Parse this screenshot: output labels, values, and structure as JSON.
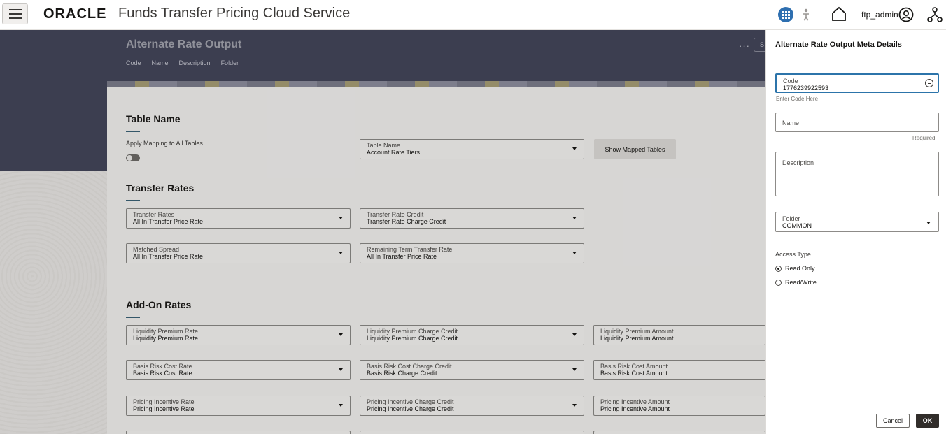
{
  "header": {
    "logo": "ORACLE",
    "app_title": "Funds Transfer Pricing Cloud Service",
    "username": "ftp_admin"
  },
  "page": {
    "title": "Alternate Rate Output",
    "subnav": [
      "Code",
      "Name",
      "Description",
      "Folder"
    ],
    "more": "···",
    "save_stub": "S"
  },
  "table_name_section": {
    "title": "Table Name",
    "apply_mapping_label": "Apply Mapping to All Tables",
    "table_dropdown": {
      "label": "Table Name",
      "value": "Account Rate Tiers"
    },
    "show_mapped_label": "Show Mapped Tables"
  },
  "transfer_rates_section": {
    "title": "Transfer Rates",
    "fields": [
      {
        "label": "Transfer Rates",
        "value": "All In Transfer Price Rate"
      },
      {
        "label": "Transfer Rate Credit",
        "value": "Transfer Rate Charge Credit"
      },
      {
        "label": "Matched Spread",
        "value": "All In Transfer Price Rate"
      },
      {
        "label": "Remaining Term Transfer Rate",
        "value": "All In Transfer Price Rate"
      }
    ]
  },
  "addon_section": {
    "title": "Add-On Rates",
    "fields": [
      {
        "label": "Liquidity Premium Rate",
        "value": "Liquidity Premium Rate"
      },
      {
        "label": "Liquidity Premium Charge Credit",
        "value": "Liquidity Premium Charge Credit"
      },
      {
        "label": "Liquidity Premium Amount",
        "value": "Liquidity Premium Amount"
      },
      {
        "label": "Basis Risk Cost Rate",
        "value": "Basis Risk Cost Rate"
      },
      {
        "label": "Basis Risk Cost Charge Credit",
        "value": "Basis Risk Charge Credit"
      },
      {
        "label": "Basis Risk Cost Amount",
        "value": "Basis Risk Cost Amount"
      },
      {
        "label": "Pricing Incentive Rate",
        "value": "Pricing Incentive Rate"
      },
      {
        "label": "Pricing Incentive Charge Credit",
        "value": "Pricing Incentive Charge Credit"
      },
      {
        "label": "Pricing Incentive Amount",
        "value": "Pricing Incentive Amount"
      }
    ]
  },
  "drawer": {
    "title": "Alternate Rate Output Meta Details",
    "code": {
      "label": "Code",
      "value": "1776239922593",
      "helper": "Enter Code Here"
    },
    "name": {
      "label": "Name",
      "value": "",
      "helper": "Required"
    },
    "description": {
      "label": "Description",
      "value": ""
    },
    "folder": {
      "label": "Folder",
      "value": "COMMON"
    },
    "access_type_label": "Access Type",
    "access_options": [
      "Read Only",
      "Read/Write"
    ],
    "access_selected": "Read Only",
    "cancel_label": "Cancel",
    "ok_label": "OK"
  },
  "colors": {
    "band": "#45475c",
    "accent_blue": "#2e6fb0",
    "ok_button": "#312d2a"
  }
}
